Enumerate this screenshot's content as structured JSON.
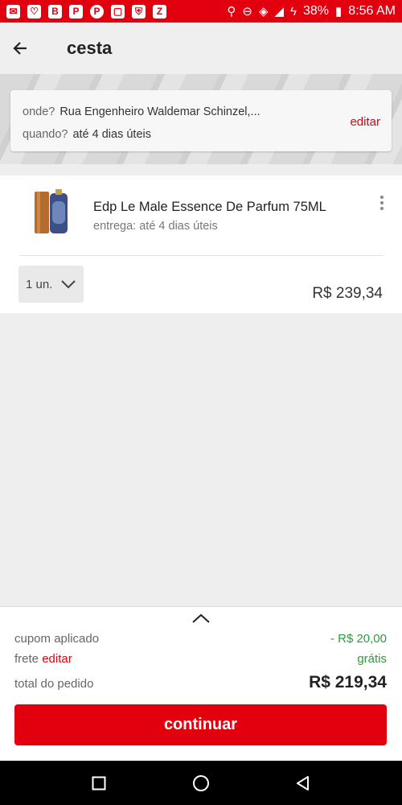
{
  "status_bar": {
    "left_icons": [
      "mail-icon",
      "heart-outline-icon",
      "bold-b-icon",
      "p-icon",
      "pinterest-icon",
      "square-icon",
      "shield-icon",
      "z-icon"
    ],
    "battery": "38%",
    "time": "8:56 AM"
  },
  "header": {
    "title": "cesta"
  },
  "delivery": {
    "where_label": "onde?",
    "where_value": "Rua Engenheiro Waldemar Schinzel,...",
    "when_label": "quando?",
    "when_value": "até 4 dias úteis",
    "edit_label": "editar"
  },
  "product": {
    "name": "Edp Le Male Essence De Parfum 75ML",
    "delivery": "entrega: até 4 dias úteis",
    "quantity": "1 un.",
    "price": "R$ 239,34"
  },
  "summary": {
    "coupon_label": "cupom aplicado",
    "coupon_value": "- R$ 20,00",
    "shipping_label": "frete",
    "shipping_edit": "editar",
    "shipping_value": "grátis",
    "total_label": "total do pedido",
    "total_value": "R$ 219,34",
    "continue_label": "continuar"
  },
  "colors": {
    "brand_red": "#e2000f",
    "free_green": "#2e9a3b"
  }
}
